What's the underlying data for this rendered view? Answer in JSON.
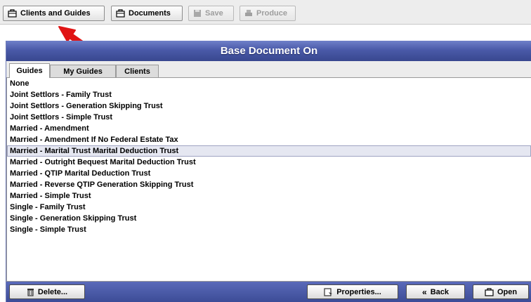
{
  "toolbar": {
    "clients_and_guides": "Clients and Guides",
    "documents": "Documents",
    "save": "Save",
    "produce": "Produce"
  },
  "panel": {
    "title": "Base Document On",
    "tabs": [
      "Guides",
      "My Guides",
      "Clients"
    ],
    "active_tab": "Guides",
    "items": [
      "None",
      "Joint Settlors - Family Trust",
      "Joint Settlors - Generation Skipping Trust",
      "Joint Settlors - Simple Trust",
      "Married - Amendment",
      "Married - Amendment If No Federal Estate Tax",
      "Married - Marital Trust Marital Deduction Trust",
      "Married - Outright Bequest Marital Deduction Trust",
      "Married - QTIP Marital Deduction Trust",
      "Married - Reverse QTIP Generation Skipping Trust",
      "Married - Simple Trust",
      "Single - Family Trust",
      "Single - Generation Skipping Trust",
      "Single - Simple Trust"
    ],
    "selected_item": "Married - Marital Trust Marital Deduction Trust"
  },
  "bottom": {
    "delete": "Delete...",
    "properties": "Properties...",
    "back": "Back",
    "open": "Open"
  },
  "colors": {
    "title_bar": "#4a5aa8",
    "selection": "#e5e7f1",
    "annotation_arrow": "#e01515"
  },
  "icons": {
    "clients_and_guides": "briefcase-icon",
    "documents": "briefcase-icon",
    "save": "disk-icon",
    "produce": "printer-icon",
    "delete": "trash-icon",
    "properties": "properties-icon",
    "back": "double-chevron-left-icon",
    "open": "open-folder-icon"
  }
}
